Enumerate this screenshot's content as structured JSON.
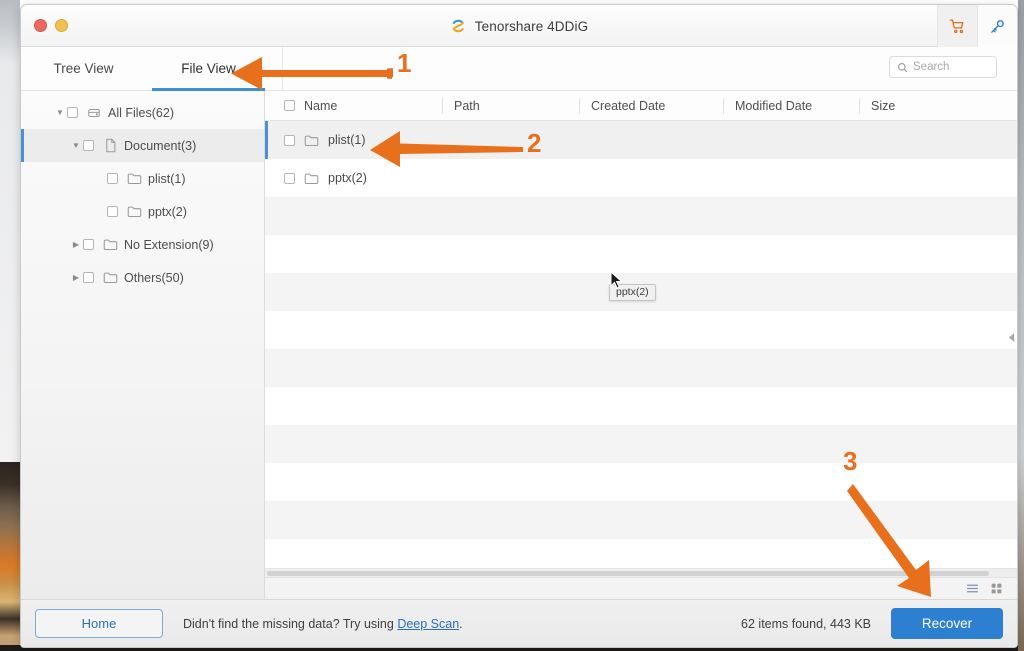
{
  "window": {
    "title": "Tenorshare 4DDiG",
    "logo_icon": "4ddig-logo-icon",
    "traffic_lights": [
      "close-red",
      "minimize-yellow"
    ],
    "actions": [
      {
        "name": "cart-icon",
        "label": "Cart"
      },
      {
        "name": "key-icon",
        "label": "License Key"
      }
    ]
  },
  "toolbar": {
    "tabs": [
      {
        "label": "Tree View",
        "active": false
      },
      {
        "label": "File View",
        "active": true
      }
    ],
    "search": {
      "placeholder": "Search",
      "value": "",
      "icon": "search-icon"
    }
  },
  "sidebar": {
    "items": [
      {
        "label": "All Files(62)",
        "indent": 0,
        "twisty": "down",
        "icon": "drive-icon",
        "selected": false
      },
      {
        "label": "Document(3)",
        "indent": 1,
        "twisty": "down",
        "icon": "file-icon",
        "selected": true
      },
      {
        "label": "plist(1)",
        "indent": 2,
        "twisty": "none",
        "icon": "folder-icon",
        "selected": false
      },
      {
        "label": "pptx(2)",
        "indent": 2,
        "twisty": "none",
        "icon": "folder-icon",
        "selected": false
      },
      {
        "label": "No Extension(9)",
        "indent": 1,
        "twisty": "right",
        "icon": "folder-icon",
        "selected": false
      },
      {
        "label": "Others(50)",
        "indent": 1,
        "twisty": "right",
        "icon": "folder-icon",
        "selected": false
      }
    ]
  },
  "file_list": {
    "columns": [
      "Name",
      "Path",
      "Created Date",
      "Modified Date",
      "Size"
    ],
    "rows": [
      {
        "name": "plist(1)",
        "path": "",
        "created": "",
        "modified": "",
        "size": "",
        "icon": "folder-icon",
        "selected": true
      },
      {
        "name": "pptx(2)",
        "path": "",
        "created": "",
        "modified": "",
        "size": "",
        "icon": "folder-icon",
        "selected": false
      }
    ],
    "empty_row_count": 11,
    "tooltip": "pptx(2)",
    "view_modes": [
      {
        "name": "list-view-icon",
        "active": true
      },
      {
        "name": "grid-view-icon",
        "active": false
      }
    ],
    "collapse_handle_icon": "chevron-left-icon"
  },
  "footer": {
    "home_label": "Home",
    "hint_prefix": "Didn't find the missing data? Try using ",
    "hint_link": "Deep Scan",
    "hint_suffix": ".",
    "found_text": "62 items found, 443 KB",
    "recover_label": "Recover"
  },
  "annotations": [
    {
      "number": "1",
      "points_to": "file-view-tab"
    },
    {
      "number": "2",
      "points_to": "file-row-plist"
    },
    {
      "number": "3",
      "points_to": "recover-button"
    }
  ],
  "colors": {
    "accent_orange": "#e8701c",
    "accent_blue": "#2c7fd1",
    "tab_underline": "#3d8fd6",
    "selection_bar": "#4a90d9"
  }
}
